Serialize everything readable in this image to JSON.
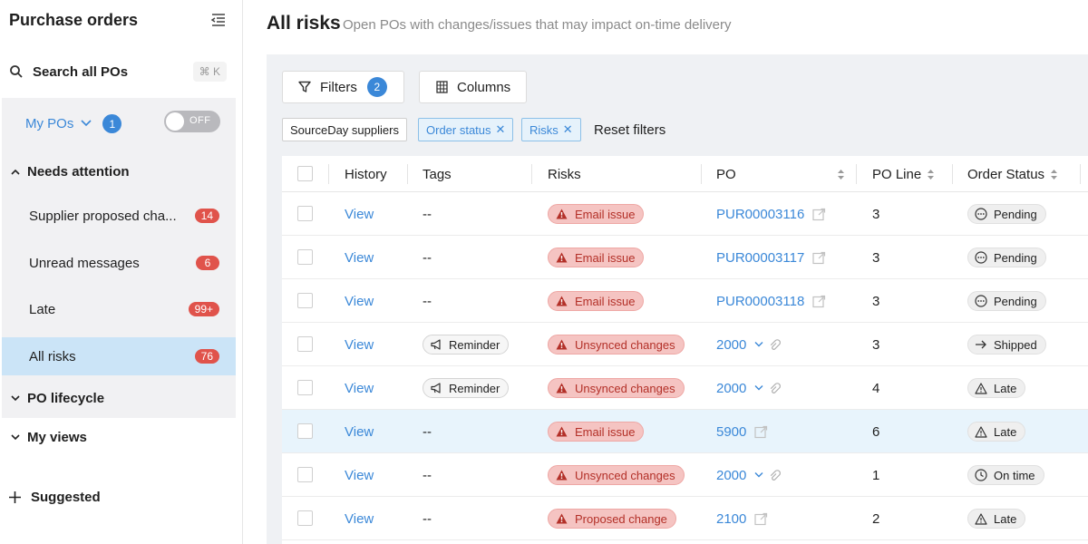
{
  "sidebar": {
    "title": "Purchase orders",
    "search_label": "Search all POs",
    "search_shortcut": "⌘ K",
    "my_pos": {
      "label": "My POs",
      "count": "1",
      "toggle_label": "OFF"
    },
    "needs_attention": {
      "label": "Needs attention",
      "items": [
        {
          "label": "Supplier proposed cha...",
          "count": "14"
        },
        {
          "label": "Unread messages",
          "count": "6"
        },
        {
          "label": "Late",
          "count": "99+"
        },
        {
          "label": "All risks",
          "count": "76"
        }
      ]
    },
    "po_lifecycle": "PO lifecycle",
    "my_views": "My views",
    "suggested": "Suggested"
  },
  "main": {
    "title": "All risks",
    "subtitle": "Open POs with changes/issues that may impact on-time delivery",
    "filters_label": "Filters",
    "filters_count": "2",
    "columns_label": "Columns",
    "chips": [
      {
        "label": "SourceDay suppliers",
        "selected": false
      },
      {
        "label": "Order status",
        "selected": true
      },
      {
        "label": "Risks",
        "selected": true
      }
    ],
    "reset_filters": "Reset filters"
  },
  "table": {
    "columns": [
      "History",
      "Tags",
      "Risks",
      "PO",
      "PO Line",
      "Order Status"
    ],
    "rows": [
      {
        "history": "View",
        "tags": "--",
        "risk": "Email issue",
        "po": "PUR00003116",
        "po_icon": "external-link-icon",
        "line": "3",
        "status": "Pending",
        "status_icon": "pending-icon"
      },
      {
        "history": "View",
        "tags": "--",
        "risk": "Email issue",
        "po": "PUR00003117",
        "po_icon": "external-link-icon",
        "line": "3",
        "status": "Pending",
        "status_icon": "pending-icon"
      },
      {
        "history": "View",
        "tags": "--",
        "risk": "Email issue",
        "po": "PUR00003118",
        "po_icon": "external-link-icon",
        "line": "3",
        "status": "Pending",
        "status_icon": "pending-icon"
      },
      {
        "history": "View",
        "tags": "Reminder",
        "risk": "Unsynced changes",
        "po": "2000",
        "po_icon": "chevron-attachment-icon",
        "line": "3",
        "status": "Shipped",
        "status_icon": "arrow-right-icon"
      },
      {
        "history": "View",
        "tags": "Reminder",
        "risk": "Unsynced changes",
        "po": "2000",
        "po_icon": "chevron-attachment-icon",
        "line": "4",
        "status": "Late",
        "status_icon": "warning-icon"
      },
      {
        "history": "View",
        "tags": "--",
        "risk": "Email issue",
        "po": "5900",
        "po_icon": "external-link-icon",
        "line": "6",
        "status": "Late",
        "status_icon": "warning-icon"
      },
      {
        "history": "View",
        "tags": "--",
        "risk": "Unsynced changes",
        "po": "2000",
        "po_icon": "chevron-attachment-icon",
        "line": "1",
        "status": "On time",
        "status_icon": "clock-icon"
      },
      {
        "history": "View",
        "tags": "--",
        "risk": "Proposed change",
        "po": "2100",
        "po_icon": "external-link-icon",
        "line": "2",
        "status": "Late",
        "status_icon": "warning-icon"
      }
    ]
  }
}
